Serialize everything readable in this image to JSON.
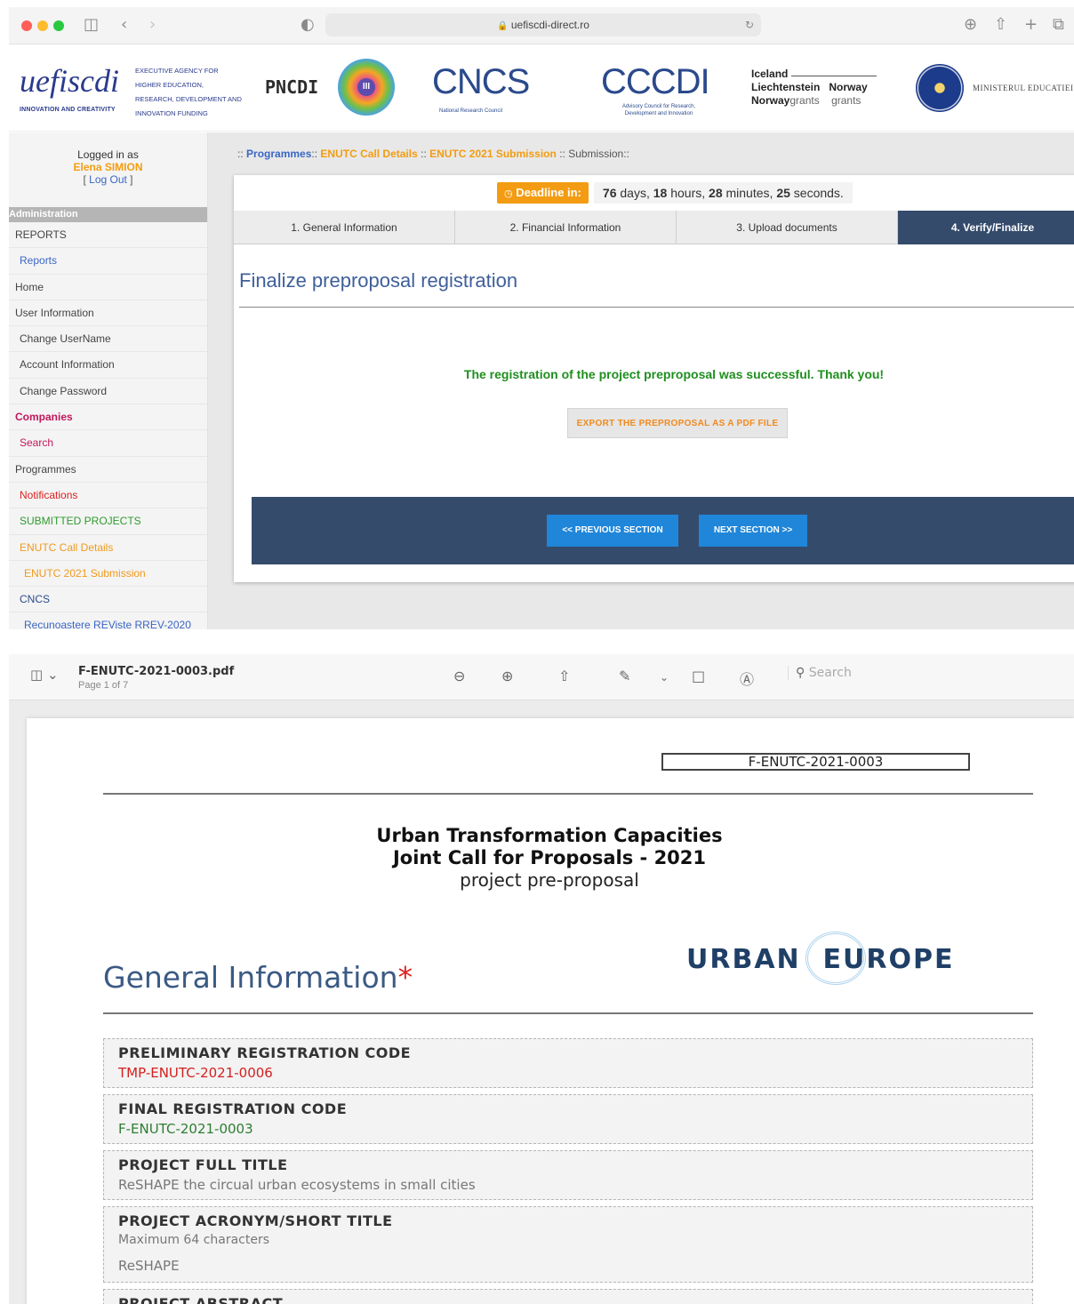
{
  "browser": {
    "url": "uefiscdi-direct.ro"
  },
  "logos": {
    "uefiscdi": "uefiscdi",
    "uefiscdi_sub": "INNOVATION AND CREATIVITY",
    "uefiscdi_agency": "EXECUTIVE AGENCY FOR HIGHER EDUCATION, RESEARCH, DEVELOPMENT AND INNOVATION FUNDING",
    "pncdi": "PNCDI",
    "pncdi_num": "III",
    "cncs": "CNCS",
    "cncs_sub": "National Research Council",
    "cccdi": "CCCDI",
    "cccdi_sub": "Advisory Council for Research, Development and Innovation",
    "grants_line1_a": "Iceland",
    "grants_line2_a": "Liechtenstein",
    "grants_line2_b": "Norway",
    "grants_line3_a": "Norway",
    "grants_line3_b": "grants",
    "grants_line3_c": "grants",
    "ministry": "MINISTERUL EDUCATIEI"
  },
  "login": {
    "logged_in_as": "Logged in as",
    "user_name": "Elena SIMION",
    "logout": "Log Out"
  },
  "sidebar": {
    "header": "Administration",
    "items": [
      {
        "label": "REPORTS"
      },
      {
        "label": "Reports"
      },
      {
        "label": "Home"
      },
      {
        "label": "User Information"
      },
      {
        "label": "Change UserName"
      },
      {
        "label": "Account Information"
      },
      {
        "label": "Change Password"
      },
      {
        "label": "Companies"
      },
      {
        "label": "Search"
      },
      {
        "label": "Programmes"
      },
      {
        "label": "Notifications"
      },
      {
        "label": "SUBMITTED PROJECTS"
      },
      {
        "label": "ENUTC Call Details"
      },
      {
        "label": "ENUTC 2021 Submission"
      },
      {
        "label": "CNCS"
      },
      {
        "label": "Recunoastere REViste RREV-2020"
      }
    ]
  },
  "breadcrumb": {
    "sep": "::",
    "items": [
      "Programmes",
      "ENUTC Call Details",
      "ENUTC 2021 Submission",
      "Submission"
    ]
  },
  "deadline": {
    "label": "Deadline in:",
    "days": "76",
    "days_unit": "days,",
    "hours": "18",
    "hours_unit": "hours,",
    "minutes": "28",
    "minutes_unit": "minutes,",
    "seconds": "25",
    "seconds_unit": "seconds."
  },
  "tabs": [
    {
      "label": "1. General Information"
    },
    {
      "label": "2. Financial Information"
    },
    {
      "label": "3. Upload documents"
    },
    {
      "label": "4. Verify/Finalize"
    }
  ],
  "finalize": {
    "title": "Finalize preproposal registration",
    "success_message": "The registration of the project preproposal was successful. Thank you!",
    "export_button": "EXPORT THE PREPROPOSAL AS A PDF FILE",
    "prev_button": "<< PREVIOUS SECTION",
    "next_button": "NEXT SECTION >>"
  },
  "pdf_viewer": {
    "file_name": "F-ENUTC-2021-0003.pdf",
    "page_info": "Page 1 of 7",
    "search_placeholder": "Search"
  },
  "pdf_page": {
    "code_box": "F-ENUTC-2021-0003",
    "title_line1": "Urban Transformation Capacities",
    "title_line2": "Joint Call for Proposals - 2021",
    "subtitle": "project pre-proposal",
    "logo_text_left": "URBAN",
    "logo_text_right": "EUROPE",
    "section_title": "General Information",
    "section_star": "*",
    "fields": [
      {
        "label": "PRELIMINARY REGISTRATION CODE",
        "value": "TMP-ENUTC-2021-0006"
      },
      {
        "label": "FINAL REGISTRATION CODE",
        "value": "F-ENUTC-2021-0003"
      },
      {
        "label": "PROJECT FULL TITLE",
        "value": "ReSHAPE the circual urban ecosystems in small cities"
      },
      {
        "label": "PROJECT ACRONYM/SHORT TITLE",
        "hint": "Maximum 64 characters",
        "value": "ReSHAPE"
      },
      {
        "label": "PROJECT ABSTRACT"
      }
    ]
  },
  "colors": {
    "accent_blue": "#3a66c4",
    "nav_dark": "#344b6c",
    "deadline_orange": "#f39c12",
    "success_green": "#1f8f1f"
  }
}
